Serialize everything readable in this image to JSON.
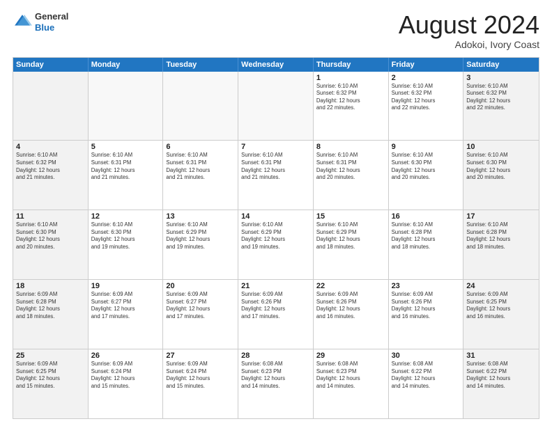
{
  "header": {
    "logo": {
      "general": "General",
      "blue": "Blue"
    },
    "title": "August 2024",
    "location": "Adokoi, Ivory Coast"
  },
  "weekdays": [
    "Sunday",
    "Monday",
    "Tuesday",
    "Wednesday",
    "Thursday",
    "Friday",
    "Saturday"
  ],
  "weeks": [
    [
      {
        "day": "",
        "empty": true
      },
      {
        "day": "",
        "empty": true
      },
      {
        "day": "",
        "empty": true
      },
      {
        "day": "",
        "empty": true
      },
      {
        "day": "1",
        "sunrise": "6:10 AM",
        "sunset": "6:32 PM",
        "daylight": "12 hours and 22 minutes."
      },
      {
        "day": "2",
        "sunrise": "6:10 AM",
        "sunset": "6:32 PM",
        "daylight": "12 hours and 22 minutes."
      },
      {
        "day": "3",
        "sunrise": "6:10 AM",
        "sunset": "6:32 PM",
        "daylight": "12 hours and 22 minutes."
      }
    ],
    [
      {
        "day": "4",
        "sunrise": "6:10 AM",
        "sunset": "6:32 PM",
        "daylight": "12 hours and 21 minutes."
      },
      {
        "day": "5",
        "sunrise": "6:10 AM",
        "sunset": "6:31 PM",
        "daylight": "12 hours and 21 minutes."
      },
      {
        "day": "6",
        "sunrise": "6:10 AM",
        "sunset": "6:31 PM",
        "daylight": "12 hours and 21 minutes."
      },
      {
        "day": "7",
        "sunrise": "6:10 AM",
        "sunset": "6:31 PM",
        "daylight": "12 hours and 21 minutes."
      },
      {
        "day": "8",
        "sunrise": "6:10 AM",
        "sunset": "6:31 PM",
        "daylight": "12 hours and 20 minutes."
      },
      {
        "day": "9",
        "sunrise": "6:10 AM",
        "sunset": "6:30 PM",
        "daylight": "12 hours and 20 minutes."
      },
      {
        "day": "10",
        "sunrise": "6:10 AM",
        "sunset": "6:30 PM",
        "daylight": "12 hours and 20 minutes."
      }
    ],
    [
      {
        "day": "11",
        "sunrise": "6:10 AM",
        "sunset": "6:30 PM",
        "daylight": "12 hours and 20 minutes."
      },
      {
        "day": "12",
        "sunrise": "6:10 AM",
        "sunset": "6:30 PM",
        "daylight": "12 hours and 19 minutes."
      },
      {
        "day": "13",
        "sunrise": "6:10 AM",
        "sunset": "6:29 PM",
        "daylight": "12 hours and 19 minutes."
      },
      {
        "day": "14",
        "sunrise": "6:10 AM",
        "sunset": "6:29 PM",
        "daylight": "12 hours and 19 minutes."
      },
      {
        "day": "15",
        "sunrise": "6:10 AM",
        "sunset": "6:29 PM",
        "daylight": "12 hours and 18 minutes."
      },
      {
        "day": "16",
        "sunrise": "6:10 AM",
        "sunset": "6:28 PM",
        "daylight": "12 hours and 18 minutes."
      },
      {
        "day": "17",
        "sunrise": "6:10 AM",
        "sunset": "6:28 PM",
        "daylight": "12 hours and 18 minutes."
      }
    ],
    [
      {
        "day": "18",
        "sunrise": "6:09 AM",
        "sunset": "6:28 PM",
        "daylight": "12 hours and 18 minutes."
      },
      {
        "day": "19",
        "sunrise": "6:09 AM",
        "sunset": "6:27 PM",
        "daylight": "12 hours and 17 minutes."
      },
      {
        "day": "20",
        "sunrise": "6:09 AM",
        "sunset": "6:27 PM",
        "daylight": "12 hours and 17 minutes."
      },
      {
        "day": "21",
        "sunrise": "6:09 AM",
        "sunset": "6:26 PM",
        "daylight": "12 hours and 17 minutes."
      },
      {
        "day": "22",
        "sunrise": "6:09 AM",
        "sunset": "6:26 PM",
        "daylight": "12 hours and 16 minutes."
      },
      {
        "day": "23",
        "sunrise": "6:09 AM",
        "sunset": "6:26 PM",
        "daylight": "12 hours and 16 minutes."
      },
      {
        "day": "24",
        "sunrise": "6:09 AM",
        "sunset": "6:25 PM",
        "daylight": "12 hours and 16 minutes."
      }
    ],
    [
      {
        "day": "25",
        "sunrise": "6:09 AM",
        "sunset": "6:25 PM",
        "daylight": "12 hours and 15 minutes."
      },
      {
        "day": "26",
        "sunrise": "6:09 AM",
        "sunset": "6:24 PM",
        "daylight": "12 hours and 15 minutes."
      },
      {
        "day": "27",
        "sunrise": "6:09 AM",
        "sunset": "6:24 PM",
        "daylight": "12 hours and 15 minutes."
      },
      {
        "day": "28",
        "sunrise": "6:08 AM",
        "sunset": "6:23 PM",
        "daylight": "12 hours and 14 minutes."
      },
      {
        "day": "29",
        "sunrise": "6:08 AM",
        "sunset": "6:23 PM",
        "daylight": "12 hours and 14 minutes."
      },
      {
        "day": "30",
        "sunrise": "6:08 AM",
        "sunset": "6:22 PM",
        "daylight": "12 hours and 14 minutes."
      },
      {
        "day": "31",
        "sunrise": "6:08 AM",
        "sunset": "6:22 PM",
        "daylight": "12 hours and 14 minutes."
      }
    ]
  ],
  "labels": {
    "sunrise": "Sunrise:",
    "sunset": "Sunset:",
    "daylight": "Daylight:"
  }
}
